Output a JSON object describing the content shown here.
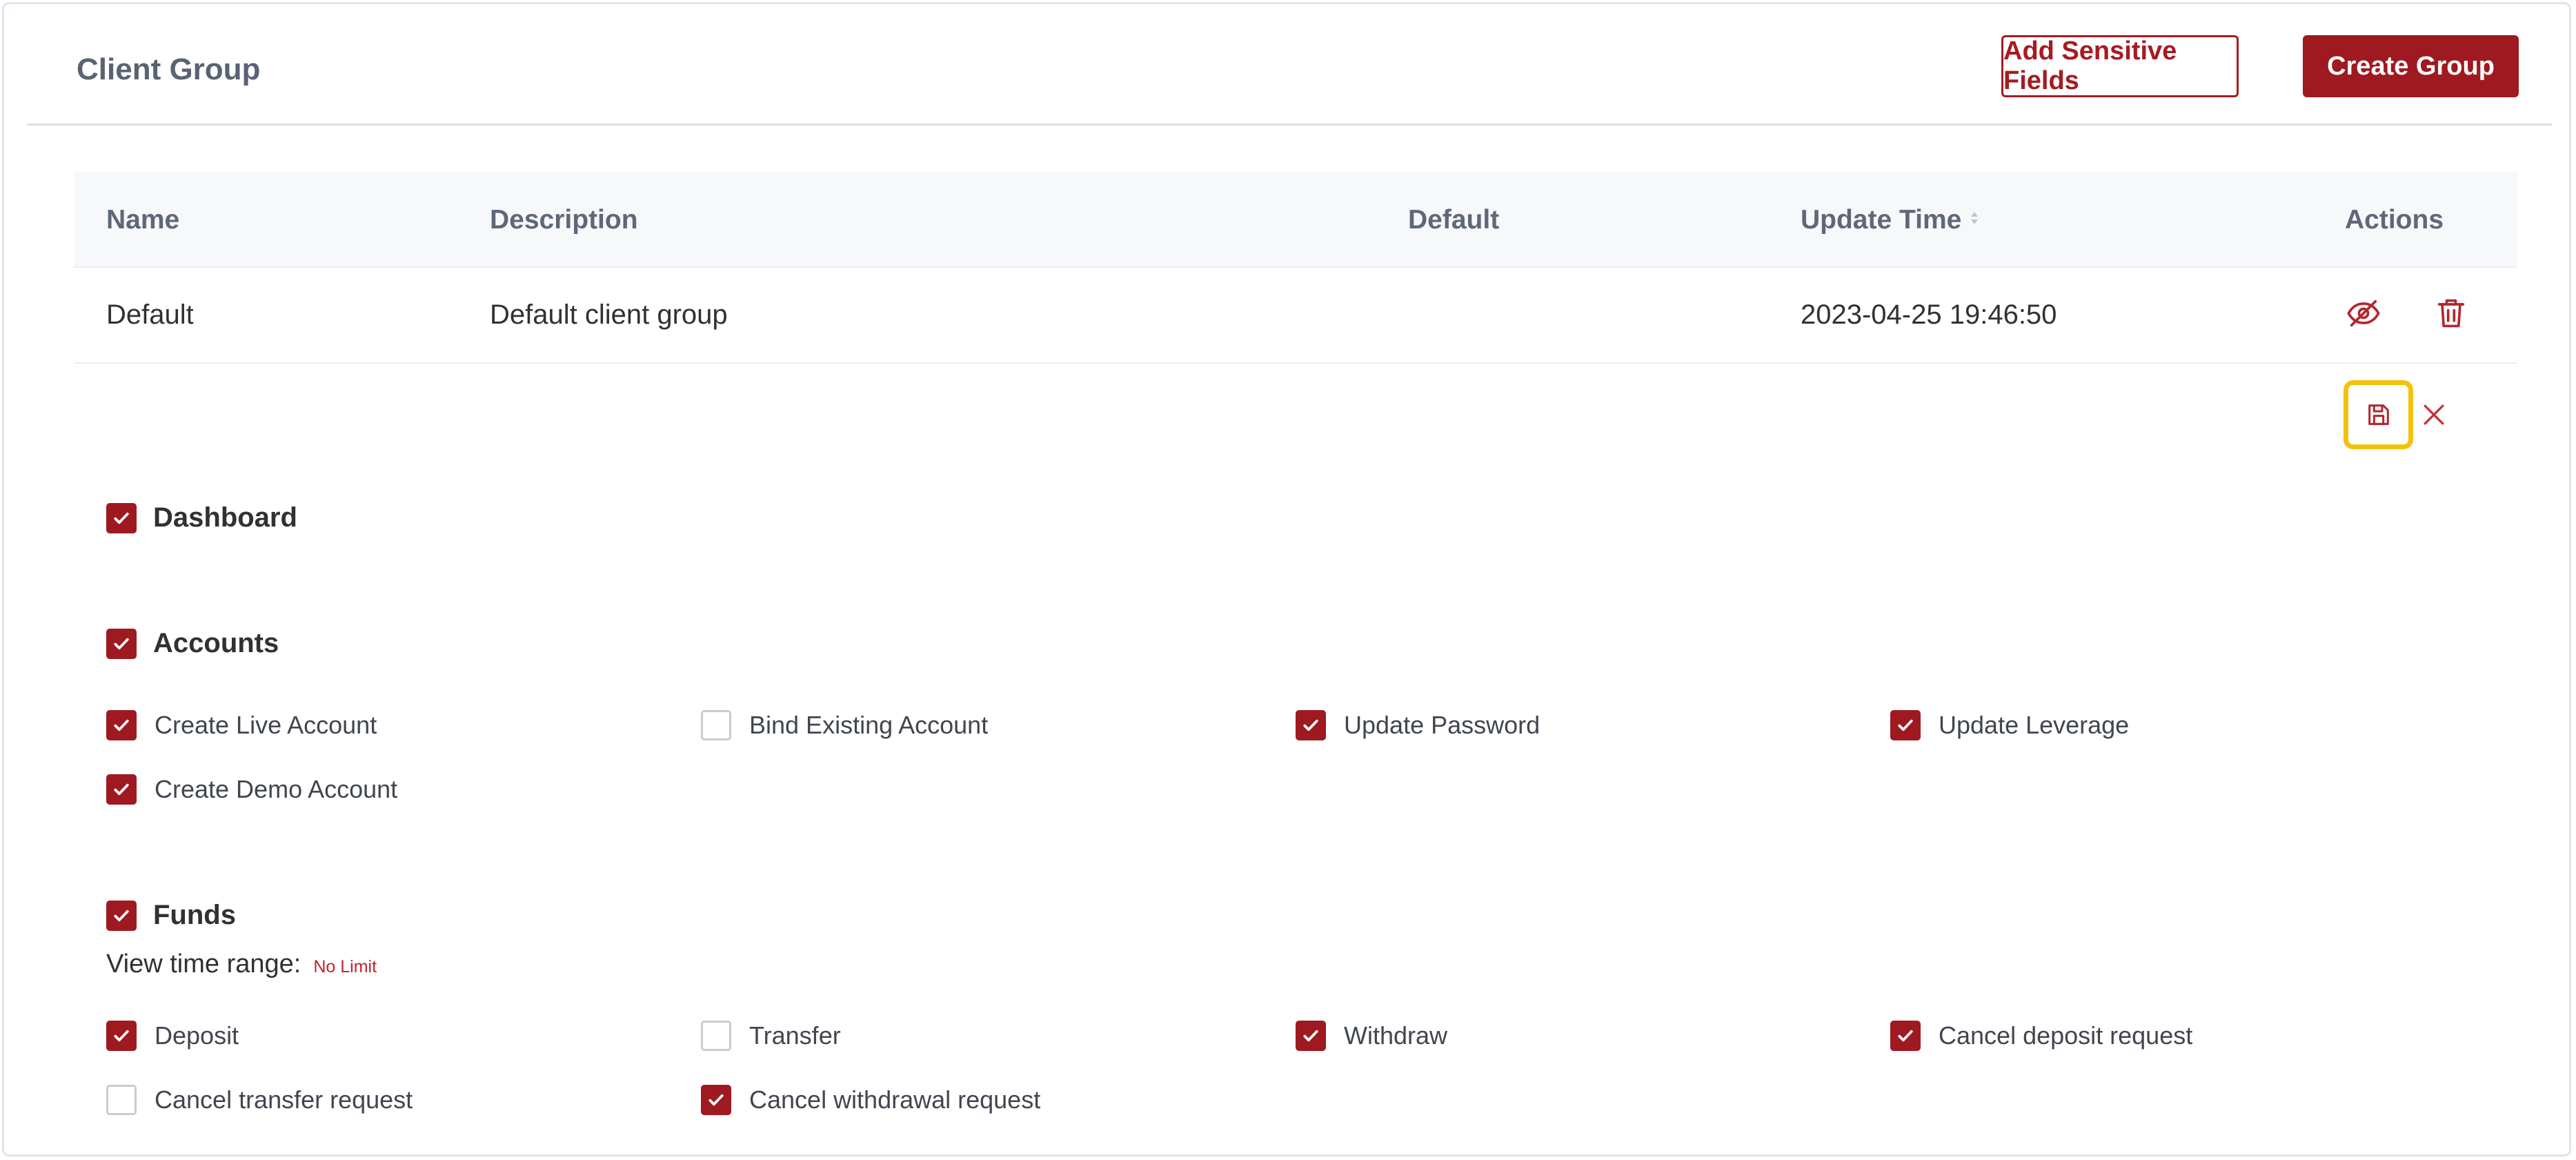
{
  "header": {
    "title": "Client Group",
    "add_sensitive_label": "Add Sensitive Fields",
    "create_group_label": "Create Group"
  },
  "table": {
    "columns": [
      "Name",
      "Description",
      "Default",
      "Update Time",
      "Actions"
    ],
    "rows": [
      {
        "name": "Default",
        "description": "Default client group",
        "default": "",
        "update_time": "2023-04-25 19:46:50"
      }
    ]
  },
  "icons": {
    "row_actions": [
      "eye-off-icon",
      "trash-icon"
    ],
    "edit_actions": [
      "save-icon",
      "close-icon"
    ]
  },
  "colors": {
    "accent": "#9e1a20",
    "highlight": "#f4c20d",
    "border": "#dcdfe6"
  },
  "permissions": {
    "dashboard": {
      "label": "Dashboard",
      "checked": true
    },
    "accounts": {
      "label": "Accounts",
      "checked": true,
      "items": [
        {
          "label": "Create Live Account",
          "checked": true
        },
        {
          "label": "Bind Existing Account",
          "checked": false
        },
        {
          "label": "Update Password",
          "checked": true
        },
        {
          "label": "Update Leverage",
          "checked": true
        },
        {
          "label": "Create Demo Account",
          "checked": true
        }
      ]
    },
    "funds": {
      "label": "Funds",
      "checked": true,
      "range_label": "View time range:",
      "range_value": "No Limit",
      "items": [
        {
          "label": "Deposit",
          "checked": true
        },
        {
          "label": "Transfer",
          "checked": false
        },
        {
          "label": "Withdraw",
          "checked": true
        },
        {
          "label": "Cancel deposit request",
          "checked": true
        },
        {
          "label": "Cancel transfer request",
          "checked": false
        },
        {
          "label": "Cancel withdrawal request",
          "checked": true
        }
      ]
    }
  }
}
